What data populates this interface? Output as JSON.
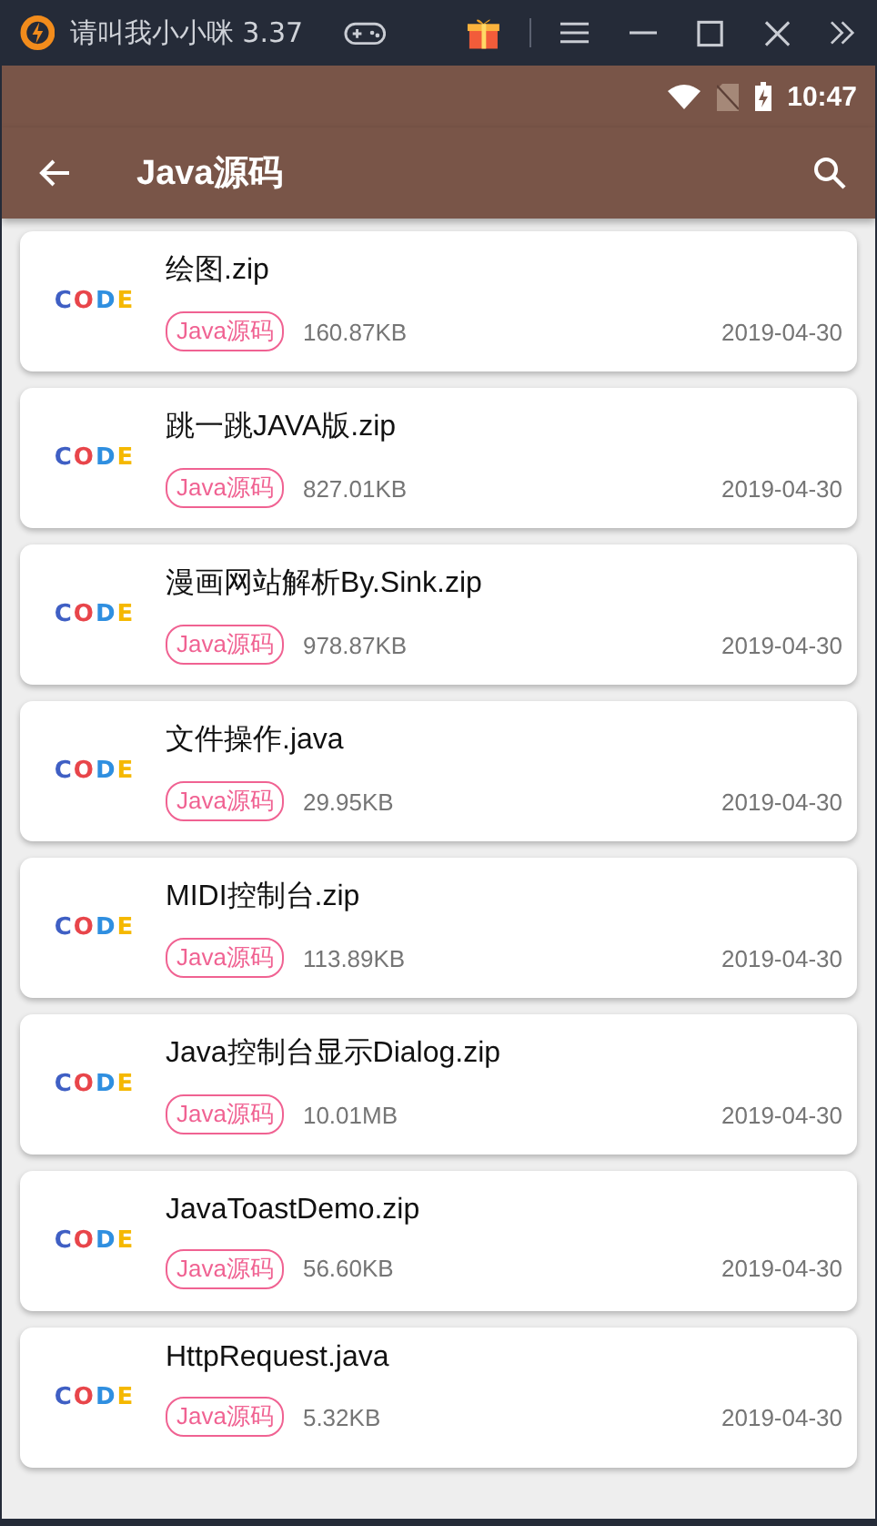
{
  "window": {
    "title": "请叫我小小咪 3.37"
  },
  "status_bar": {
    "time": "10:47"
  },
  "app_bar": {
    "title": "Java源码"
  },
  "files": [
    {
      "logo": "CODE",
      "name": "绘图.zip",
      "tag": "Java源码",
      "size": "160.87KB",
      "date": "2019-04-30"
    },
    {
      "logo": "CODE",
      "name": "跳一跳JAVA版.zip",
      "tag": "Java源码",
      "size": "827.01KB",
      "date": "2019-04-30"
    },
    {
      "logo": "CODE",
      "name": "漫画网站解析By.Sink.zip",
      "tag": "Java源码",
      "size": "978.87KB",
      "date": "2019-04-30"
    },
    {
      "logo": "CODE",
      "name": "文件操作.java",
      "tag": "Java源码",
      "size": "29.95KB",
      "date": "2019-04-30"
    },
    {
      "logo": "CODE",
      "name": "MIDI控制台.zip",
      "tag": "Java源码",
      "size": "113.89KB",
      "date": "2019-04-30"
    },
    {
      "logo": "CODE",
      "name": "Java控制台显示Dialog.zip",
      "tag": "Java源码",
      "size": "10.01MB",
      "date": "2019-04-30"
    },
    {
      "logo": "CODE",
      "name": "JavaToastDemo.zip",
      "tag": "Java源码",
      "size": "56.60KB",
      "date": "2019-04-30"
    },
    {
      "logo": "CODE",
      "name": "HttpRequest.java",
      "tag": "Java源码",
      "size": "5.32KB",
      "date": "2019-04-30"
    }
  ]
}
